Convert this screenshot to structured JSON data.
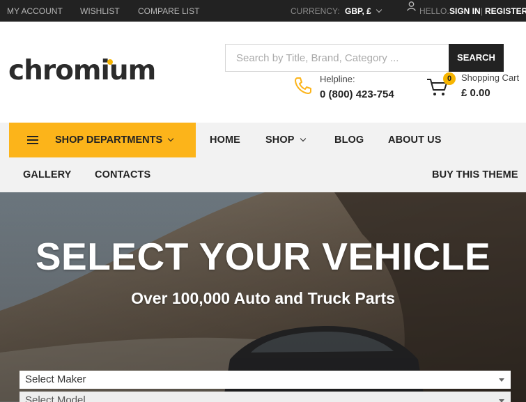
{
  "topbar": {
    "my_account": "MY ACCOUNT",
    "wishlist": "WISHLIST",
    "compare": "COMPARE LIST",
    "currency_label": "CURRENCY:",
    "currency_value": "GBP, £",
    "hello": "HELLO.",
    "sign_in": "SIGN IN",
    "separator": "|",
    "register": "REGISTER"
  },
  "header": {
    "logo": "chromium",
    "search_placeholder": "Search by Title, Brand, Category ...",
    "search_button": "SEARCH",
    "helpline_label": "Helpline:",
    "helpline_number": "0 (800) 423-754",
    "cart_count": "0",
    "cart_label": "Shopping Cart",
    "cart_total": "£ 0.00"
  },
  "nav": {
    "departments": "SHOP DEPARTMENTS",
    "home": "HOME",
    "shop": "SHOP",
    "blog": "BLOG",
    "about": "ABOUT US",
    "gallery": "GALLERY",
    "contacts": "CONTACTS",
    "buy_theme": "BUY THIS THEME"
  },
  "hero": {
    "title": "SELECT YOUR VEHICLE",
    "subtitle": "Over 100,000 Auto and Truck Parts",
    "select_maker": "Select Maker",
    "select_model": "Select Model"
  },
  "colors": {
    "accent": "#fcb41a",
    "topbar_bg": "#222222",
    "nav_bg": "#f2f2f2"
  },
  "icons": [
    "user-icon",
    "phone-icon",
    "cart-icon",
    "menu-icon",
    "chevron-down-icon"
  ]
}
